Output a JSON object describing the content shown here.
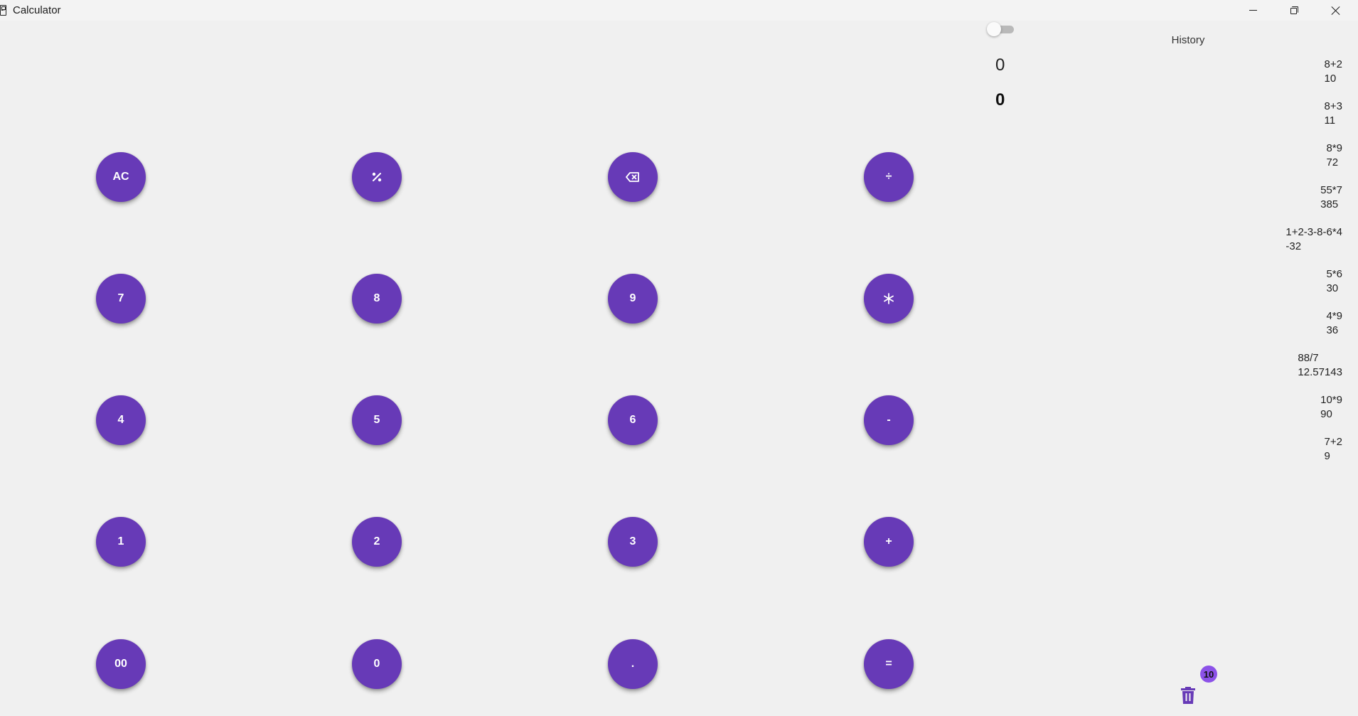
{
  "window": {
    "title": "Calculator"
  },
  "display": {
    "expression": "0",
    "result": "0",
    "toggle_on": false
  },
  "keys": [
    {
      "label": "AC",
      "icon": null
    },
    {
      "label": "",
      "icon": "percent-icon"
    },
    {
      "label": "",
      "icon": "backspace-icon"
    },
    {
      "label": "÷",
      "icon": null
    },
    {
      "label": "7",
      "icon": null
    },
    {
      "label": "8",
      "icon": null
    },
    {
      "label": "9",
      "icon": null
    },
    {
      "label": "",
      "icon": "asterisk-icon"
    },
    {
      "label": "4",
      "icon": null
    },
    {
      "label": "5",
      "icon": null
    },
    {
      "label": "6",
      "icon": null
    },
    {
      "label": "-",
      "icon": null
    },
    {
      "label": "1",
      "icon": null
    },
    {
      "label": "2",
      "icon": null
    },
    {
      "label": "3",
      "icon": null
    },
    {
      "label": "+",
      "icon": null
    },
    {
      "label": "00",
      "icon": null
    },
    {
      "label": "0",
      "icon": null
    },
    {
      "label": ".",
      "icon": null
    },
    {
      "label": "=",
      "icon": null
    }
  ],
  "history": {
    "title": "History",
    "count_badge": "10",
    "items": [
      {
        "expression": "8+2",
        "result": "10"
      },
      {
        "expression": "8+3",
        "result": "11"
      },
      {
        "expression": "8*9",
        "result": "72"
      },
      {
        "expression": "55*7",
        "result": "385"
      },
      {
        "expression": "1+2-3-8-6*4",
        "result": "-32"
      },
      {
        "expression": "5*6",
        "result": "30"
      },
      {
        "expression": "4*9",
        "result": "36"
      },
      {
        "expression": "88/7",
        "result": "12.57143"
      },
      {
        "expression": "10*9",
        "result": "90"
      },
      {
        "expression": "7+2",
        "result": "9"
      }
    ]
  },
  "colors": {
    "accent": "#673ab7",
    "badge": "#8c52e8",
    "background": "#f0f0f0"
  }
}
